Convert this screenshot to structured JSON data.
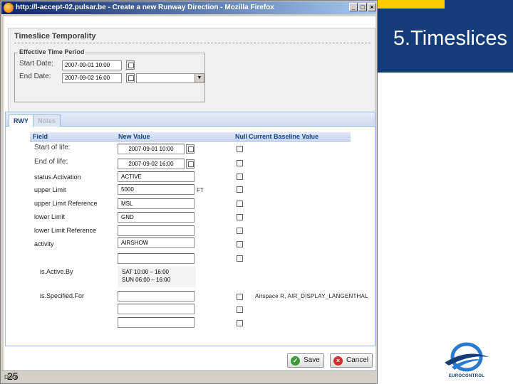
{
  "slide": {
    "title": "5.Timeslices",
    "page_number": "25"
  },
  "window": {
    "title": "http://l-accept-02.pulsar.be - Create a new Runway Direction - Mozilla Firefox",
    "minimize": "_",
    "maximize": "□",
    "close": "×",
    "status": "Done"
  },
  "temporality": {
    "title": "Timeslice Temporality",
    "legend": "Effective Time Period",
    "start_label": "Start Date:",
    "start_value": "2007-09-01 10:00",
    "end_label": "End Date:",
    "end_value": "2007-09-02 16:00",
    "select_value": ""
  },
  "tabs": [
    {
      "label": "RWY",
      "active": true
    },
    {
      "label": "Notes",
      "active": false
    }
  ],
  "grid": {
    "headers": {
      "field": "Field",
      "new_value": "New Value",
      "null": "Null",
      "baseline": "Current Baseline Value"
    },
    "rows": [
      {
        "label": "Start of life:",
        "value": "2007-09-01 10:00"
      },
      {
        "label": "End of life:",
        "value": "2007-09-02 16:00"
      },
      {
        "label": "status.Activation",
        "value": "ACTIVE"
      },
      {
        "label": "upper Limit",
        "value": "5000",
        "unit": "FT"
      },
      {
        "label": "upper Limit Reference",
        "value": "MSL"
      },
      {
        "label": "lower Limit",
        "value": "GND"
      },
      {
        "label": "lower Limit Reference",
        "value": ""
      },
      {
        "label": "activity",
        "value": "AIRSHOW"
      },
      {
        "label": "",
        "value": ""
      },
      {
        "label": "is.Active.By",
        "schedule_line1": "SAT 10:00 – 16:00",
        "schedule_line2": "SUN 06:00 – 16:00"
      },
      {
        "label": "is.Specified.For",
        "value": "",
        "baseline": "Airspace R, AIR_DISPLAY_LANGENTHAL"
      },
      {
        "label": "",
        "value": ""
      },
      {
        "label": "",
        "value": ""
      }
    ]
  },
  "buttons": {
    "save": "Save",
    "cancel": "Cancel"
  },
  "logo": {
    "text": "EUROCONTROL"
  },
  "colors": {
    "slide_blue": "#143c78",
    "slide_yellow": "#ffcc00",
    "header_text": "#15428b"
  }
}
